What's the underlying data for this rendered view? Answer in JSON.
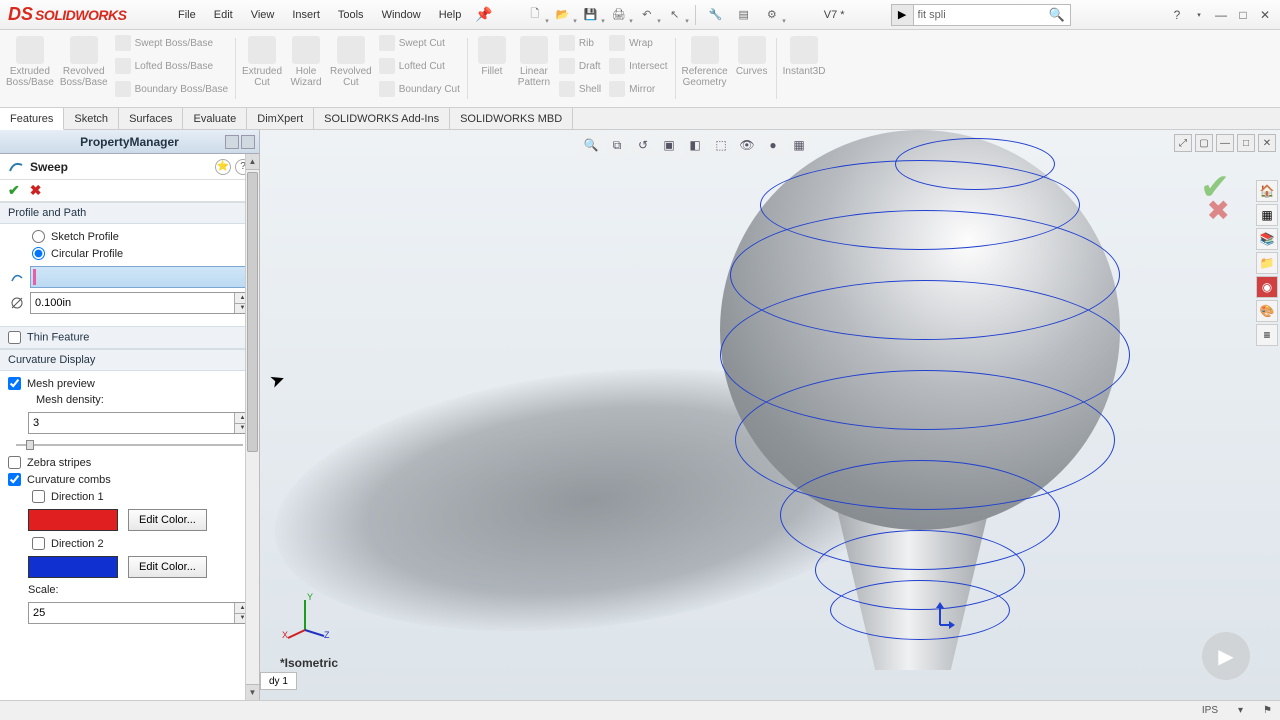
{
  "app": {
    "logo_name": "SOLIDWORKS"
  },
  "menu": {
    "file": "File",
    "edit": "Edit",
    "view": "View",
    "insert": "Insert",
    "tools": "Tools",
    "window": "Window",
    "help": "Help"
  },
  "title_tools": {
    "v7": "V7 *"
  },
  "search": {
    "placeholder": "fit spli"
  },
  "ribbon": {
    "extruded_boss": "Extruded\nBoss/Base",
    "revolved_boss": "Revolved\nBoss/Base",
    "swept_boss": "Swept Boss/Base",
    "lofted_boss": "Lofted Boss/Base",
    "boundary_boss": "Boundary Boss/Base",
    "extruded_cut": "Extruded\nCut",
    "hole_wizard": "Hole\nWizard",
    "revolved_cut": "Revolved\nCut",
    "swept_cut": "Swept Cut",
    "lofted_cut": "Lofted Cut",
    "boundary_cut": "Boundary Cut",
    "fillet": "Fillet",
    "linear_pattern": "Linear\nPattern",
    "rib": "Rib",
    "draft": "Draft",
    "shell": "Shell",
    "wrap": "Wrap",
    "intersect": "Intersect",
    "mirror": "Mirror",
    "ref_geom": "Reference\nGeometry",
    "curves": "Curves",
    "instant3d": "Instant3D"
  },
  "tabs": {
    "features": "Features",
    "sketch": "Sketch",
    "surfaces": "Surfaces",
    "evaluate": "Evaluate",
    "dimxpert": "DimXpert",
    "addins": "SOLIDWORKS Add-Ins",
    "mbd": "SOLIDWORKS MBD"
  },
  "pm": {
    "title": "PropertyManager",
    "feature": "Sweep",
    "sections": {
      "profile_path": "Profile and Path",
      "sketch_profile": "Sketch Profile",
      "circular_profile": "Circular Profile",
      "diameter": "0.100in",
      "thin_feature": "Thin Feature",
      "curvature_display": "Curvature Display",
      "mesh_preview": "Mesh preview",
      "mesh_density_label": "Mesh density:",
      "mesh_density": "3",
      "zebra": "Zebra stripes",
      "combs": "Curvature combs",
      "dir1": "Direction 1",
      "dir2": "Direction 2",
      "edit_color": "Edit Color...",
      "scale_label": "Scale:",
      "scale": "25",
      "color1": "#e02020",
      "color2": "#1030d0"
    }
  },
  "viewport": {
    "iso": "*Isometric",
    "doc_tab": "dy 1"
  },
  "status": {
    "units": "IPS"
  }
}
